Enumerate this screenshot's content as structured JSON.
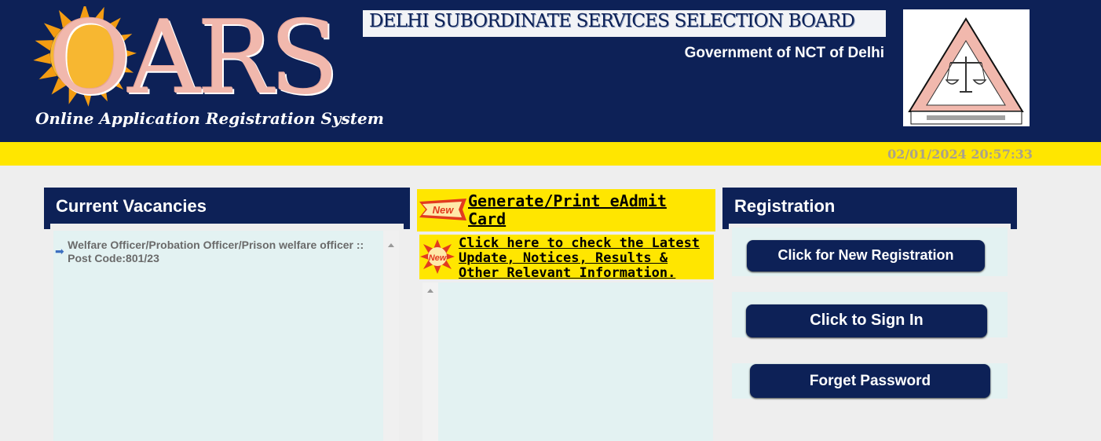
{
  "header": {
    "logo_text": "OARS",
    "tagline": "Online Application Registration System",
    "board_title": "DELHI SUBORDINATE SERVICES SELECTION BOARD",
    "government": "Government of NCT of Delhi",
    "seal_icon": "dsssb-seal-icon"
  },
  "datetime": "02/01/2024 20:57:33",
  "vacancies": {
    "title": "Current Vacancies",
    "items": [
      {
        "text": "Welfare Officer/Probation Officer/Prison welfare officer :: Post Code:801/23"
      }
    ]
  },
  "admit": {
    "badge": "New",
    "label": "Generate/Print eAdmit Card"
  },
  "notice": {
    "badge": "New",
    "label": "Click here to check the Latest Update, Notices, Results & Other Relevant Information."
  },
  "registration": {
    "title": "Registration",
    "new_registration": "Click for New Registration",
    "sign_in": "Click to Sign In",
    "forget_password": "Forget Password"
  },
  "colors": {
    "navy": "#0d2157",
    "yellow": "#ffe600",
    "panel": "#e3f2f2",
    "logo": "#f1b8ad"
  }
}
